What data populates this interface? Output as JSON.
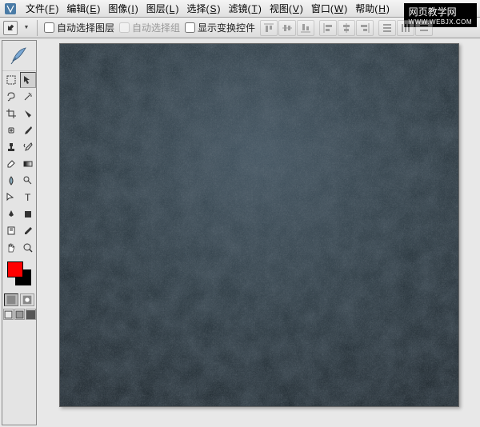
{
  "menu": {
    "file": {
      "label": "文件",
      "key": "F"
    },
    "edit": {
      "label": "编辑",
      "key": "E"
    },
    "image": {
      "label": "图像",
      "key": "I"
    },
    "layer": {
      "label": "图层",
      "key": "L"
    },
    "select": {
      "label": "选择",
      "key": "S"
    },
    "filter": {
      "label": "滤镜",
      "key": "T"
    },
    "view": {
      "label": "视图",
      "key": "V"
    },
    "window": {
      "label": "窗口",
      "key": "W"
    },
    "help": {
      "label": "帮助",
      "key": "H"
    }
  },
  "options": {
    "auto_select_layer": "自动选择图层",
    "auto_select_group": "自动选择组",
    "show_transform_controls": "显示变换控件"
  },
  "watermark": {
    "cn": "网页教学网",
    "en": "WWW.WEBJX.COM"
  },
  "colors": {
    "foreground": "#ff0000",
    "background": "#000000"
  },
  "tools": {
    "marquee": "marquee-icon",
    "move": "move-icon",
    "lasso": "lasso-icon",
    "wand": "wand-icon",
    "crop": "crop-icon",
    "slice": "slice-icon",
    "healing": "healing-icon",
    "brush": "brush-icon",
    "stamp": "stamp-icon",
    "history": "history-icon",
    "eraser": "eraser-icon",
    "gradient": "gradient-icon",
    "blur": "blur-icon",
    "dodge": "dodge-icon",
    "path": "path-icon",
    "type": "type-icon",
    "pen": "pen-icon",
    "shape": "shape-icon",
    "notes": "notes-icon",
    "eyedropper": "eyedropper-icon",
    "hand": "hand-icon",
    "zoom": "zoom-icon"
  }
}
